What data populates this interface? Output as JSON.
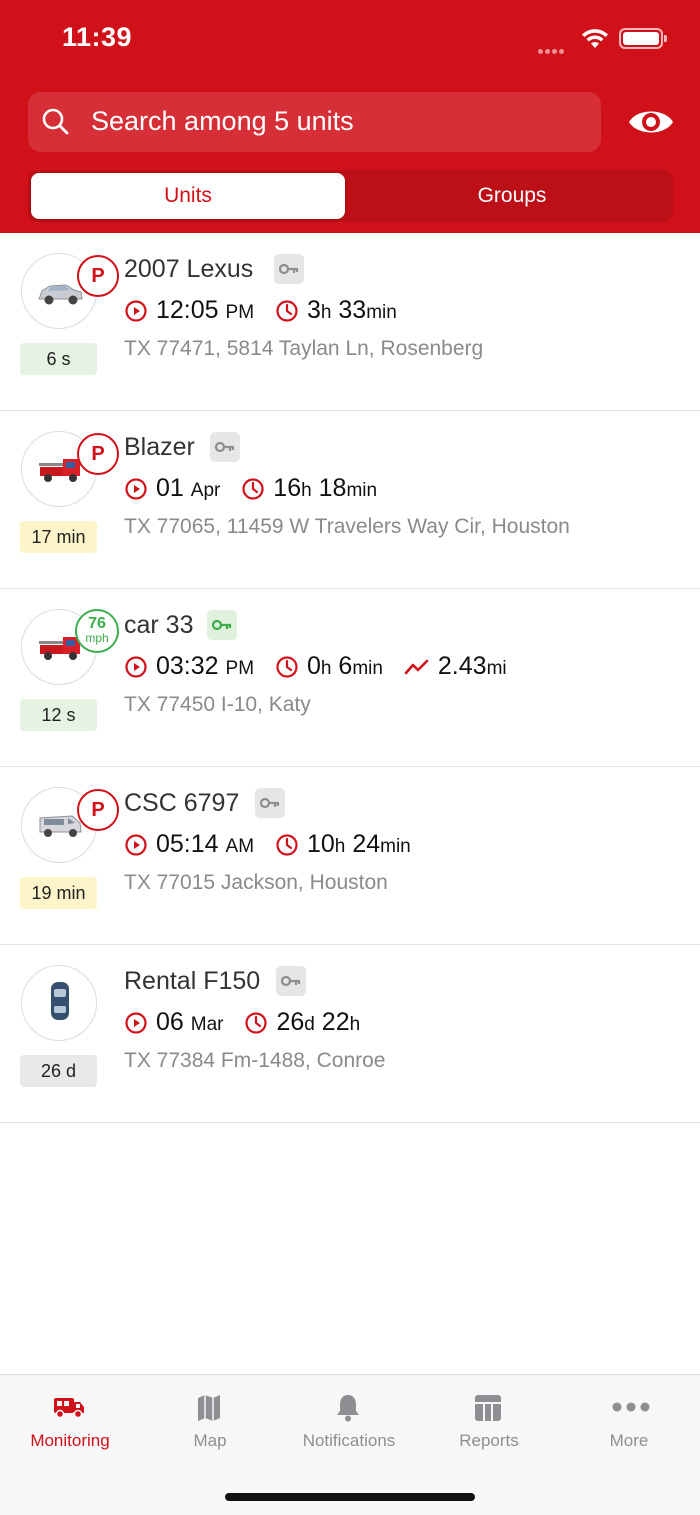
{
  "status_bar": {
    "time": "11:39"
  },
  "search": {
    "placeholder": "Search among 5 units"
  },
  "segments": {
    "units": "Units",
    "groups": "Groups"
  },
  "colors": {
    "brand_red": "#d0111a",
    "moving_green": "#3cad4a",
    "age_green": "#e5f3e3",
    "age_yellow": "#fdf5c9",
    "age_gray": "#e8e8e8"
  },
  "units": [
    {
      "name": "2007 Lexus",
      "icon": "sedan-icon",
      "status": "P",
      "ignition": "off",
      "age": "6 s",
      "time_value": "12:05",
      "time_unit": "PM",
      "dur1_value": "3",
      "dur1_unit": "h",
      "dur2_value": "33",
      "dur2_unit": "min",
      "address": "TX 77471, 5814 Taylan Ln, Rosenberg"
    },
    {
      "name": "Blazer",
      "icon": "fire-truck-icon",
      "status": "P",
      "ignition": "off",
      "age": "17 min",
      "time_value": "01",
      "time_unit": "Apr",
      "dur1_value": "16",
      "dur1_unit": "h",
      "dur2_value": "18",
      "dur2_unit": "min",
      "address": "TX 77065, 11459 W Travelers Way Cir, Houston"
    },
    {
      "name": "car 33",
      "icon": "fire-truck-icon",
      "speed_value": "76",
      "speed_unit": "mph",
      "ignition": "on",
      "age": "12 s",
      "time_value": "03:32",
      "time_unit": "PM",
      "dur1_value": "0",
      "dur1_unit": "h",
      "dur2_value": "6",
      "dur2_unit": "min",
      "distance_value": "2.43",
      "distance_unit": "mi",
      "address": "TX 77450 I-10, Katy"
    },
    {
      "name": "CSC 6797",
      "icon": "van-icon",
      "status": "P",
      "ignition": "off",
      "age": "19 min",
      "time_value": "05:14",
      "time_unit": "AM",
      "dur1_value": "10",
      "dur1_unit": "h",
      "dur2_value": "24",
      "dur2_unit": "min",
      "address": "TX 77015 Jackson, Houston"
    },
    {
      "name": "Rental F150",
      "icon": "car-top-view-icon",
      "ignition": "off",
      "age": "26 d",
      "time_value": "06",
      "time_unit": "Mar",
      "dur1_value": "26",
      "dur1_unit": "d",
      "dur2_value": "22",
      "dur2_unit": "h",
      "address": "TX 77384 Fm-1488, Conroe"
    }
  ],
  "tabbar": {
    "monitoring": "Monitoring",
    "map": "Map",
    "notifications": "Notifications",
    "reports": "Reports",
    "more": "More"
  }
}
